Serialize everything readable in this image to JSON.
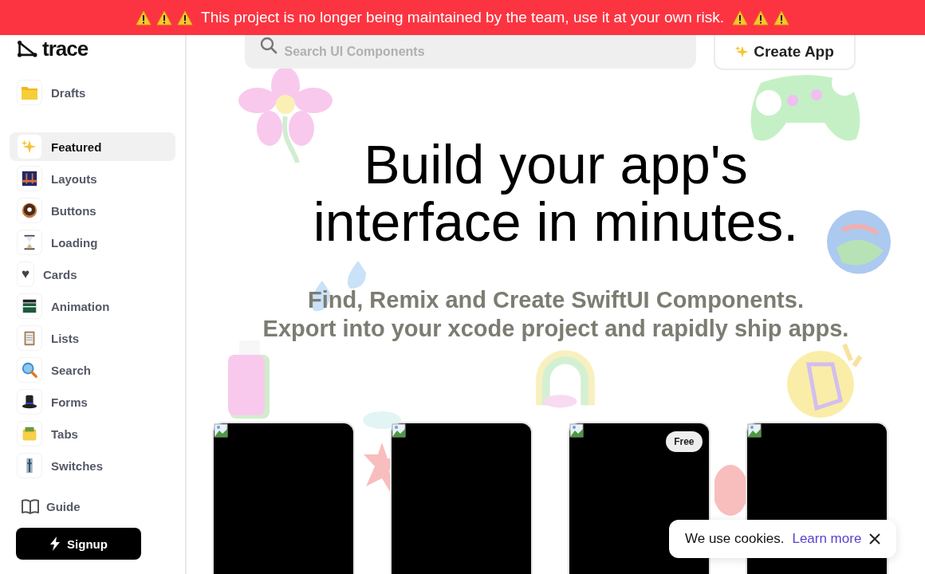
{
  "banner": {
    "text": "This project is no longer being maintained by the team, use it at your own risk."
  },
  "sidebar": {
    "logo": "trace",
    "drafts": {
      "label": "Drafts"
    },
    "items": [
      {
        "label": "Featured",
        "selected": true,
        "kind": "emoji"
      },
      {
        "label": "Layouts",
        "selected": false,
        "kind": "emoji"
      },
      {
        "label": "Buttons",
        "selected": false,
        "kind": "emoji"
      },
      {
        "label": "Loading",
        "selected": false,
        "kind": "emoji"
      },
      {
        "label": "Cards",
        "selected": false,
        "kind": "glyph",
        "glyph": "♥"
      },
      {
        "label": "Animation",
        "selected": false,
        "kind": "emoji"
      },
      {
        "label": "Lists",
        "selected": false,
        "kind": "emoji"
      },
      {
        "label": "Search",
        "selected": false,
        "kind": "emoji"
      },
      {
        "label": "Forms",
        "selected": false,
        "kind": "emoji"
      },
      {
        "label": "Tabs",
        "selected": false,
        "kind": "emoji"
      },
      {
        "label": "Switches",
        "selected": false,
        "kind": "emoji"
      }
    ],
    "guide": "Guide",
    "signup": "Signup"
  },
  "search": {
    "placeholder": "Search UI Components"
  },
  "create_button": "Create App",
  "hero": {
    "title_lines": [
      "Build your app's",
      "interface in minutes."
    ],
    "subtitle_lines": [
      "Find, Remix and Create SwiftUI Components.",
      "Export into your xcode project and rapidly ship apps."
    ]
  },
  "cards": [
    {
      "free": false
    },
    {
      "free": false
    },
    {
      "free": true,
      "badge": "Free"
    },
    {
      "free": false
    }
  ],
  "cookie": {
    "text": "We use cookies.",
    "link": "Learn more"
  }
}
